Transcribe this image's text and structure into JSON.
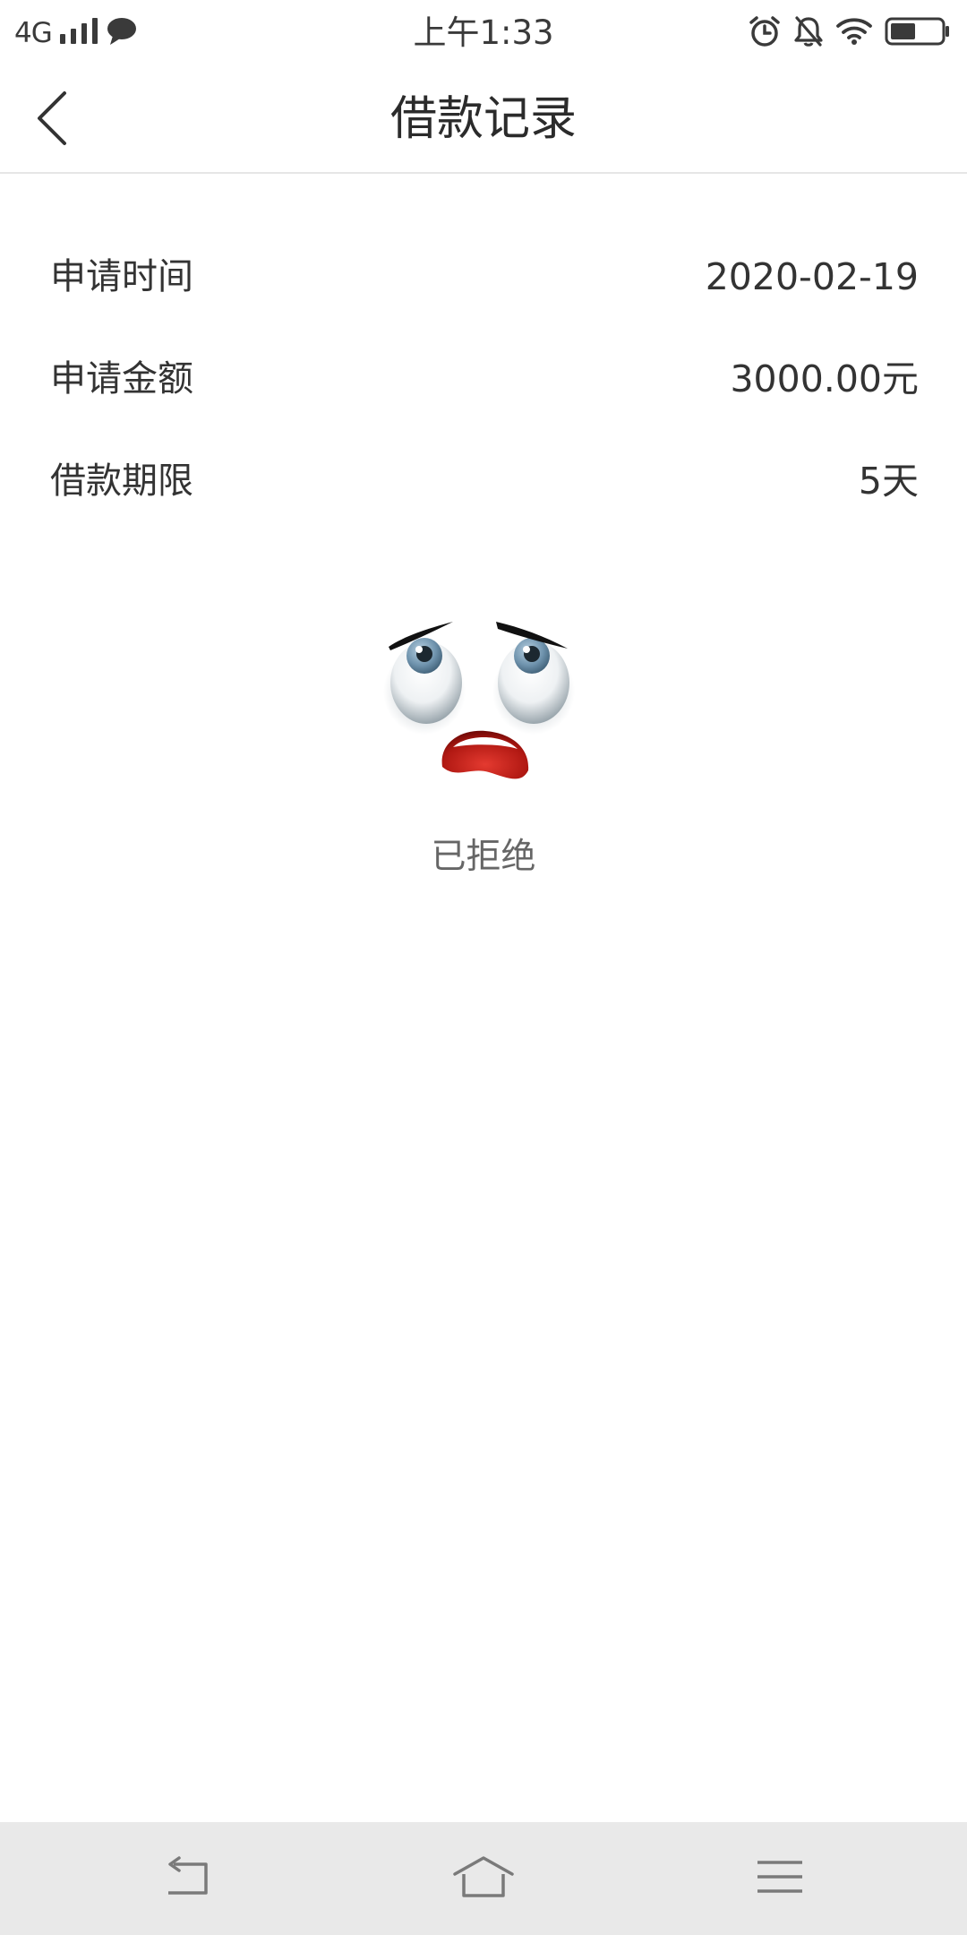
{
  "status_bar": {
    "network": "4G",
    "time": "上午1:33",
    "icons": [
      "signal-bars-icon",
      "chat-bubble-icon",
      "alarm-icon",
      "bell-off-icon",
      "wifi-icon",
      "battery-icon"
    ],
    "battery_level": 0.5
  },
  "nav": {
    "title": "借款记录",
    "back_icon": "chevron-left-icon"
  },
  "details": [
    {
      "label": "申请时间",
      "value": "2020-02-19"
    },
    {
      "label": "申请金额",
      "value": "3000.00元"
    },
    {
      "label": "借款期限",
      "value": "5天"
    }
  ],
  "status": {
    "text": "已拒绝",
    "face_icon": "rejected-face-icon"
  },
  "system_nav": {
    "icons": [
      "back-arrow-icon",
      "home-icon",
      "menu-icon"
    ]
  },
  "colors": {
    "text_primary": "#333333",
    "text_secondary": "#666666",
    "divider": "#e6e6e6",
    "system_nav_bg": "#e9e9e9"
  }
}
